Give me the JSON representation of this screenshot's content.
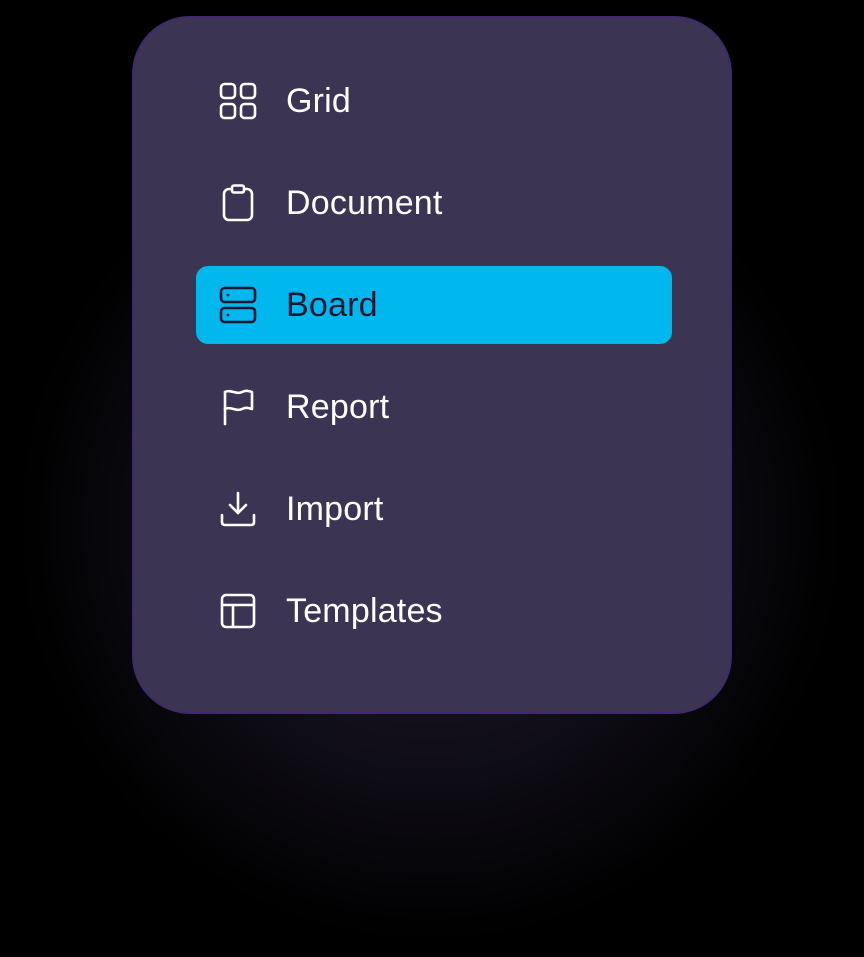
{
  "menu": {
    "items": [
      {
        "label": "Grid",
        "icon": "grid-icon",
        "active": false
      },
      {
        "label": "Document",
        "icon": "clipboard-icon",
        "active": false
      },
      {
        "label": "Board",
        "icon": "server-icon",
        "active": true
      },
      {
        "label": "Report",
        "icon": "flag-icon",
        "active": false
      },
      {
        "label": "Import",
        "icon": "download-icon",
        "active": false
      },
      {
        "label": "Templates",
        "icon": "layout-icon",
        "active": false
      }
    ]
  },
  "colors": {
    "background": "#000000",
    "card": "#3b3453",
    "card_border": "#3f2a6b",
    "active_item": "#00b8ee",
    "text": "#ffffff",
    "active_text": "#161631"
  }
}
